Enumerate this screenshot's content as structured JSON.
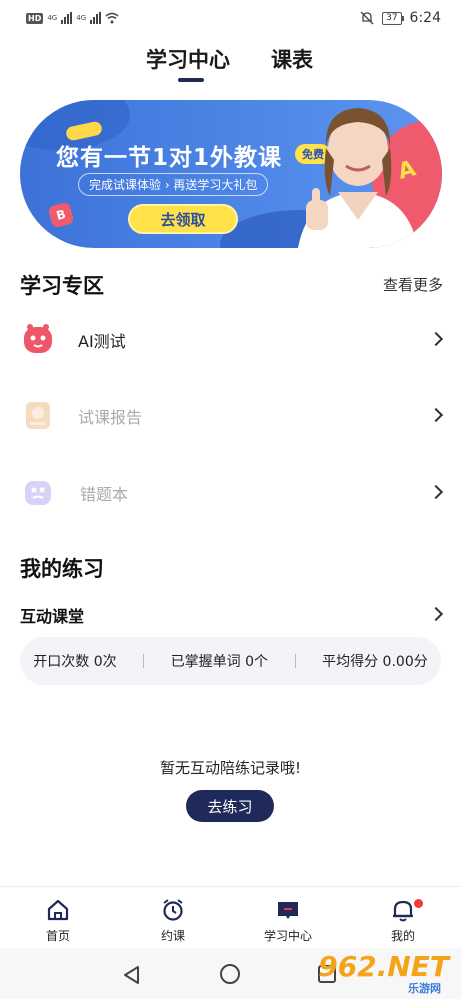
{
  "status_bar": {
    "network_hd": "HD",
    "signal1": "4G",
    "signal2": "4G",
    "battery": "37",
    "time": "6:24"
  },
  "tabs": [
    {
      "label": "学习中心"
    },
    {
      "label": "课表"
    }
  ],
  "banner": {
    "title": "您有一节1对1外教课",
    "free_badge": "免费",
    "subtitle": "完成试课体验 › 再送学习大礼包",
    "button": "去领取"
  },
  "study_zone": {
    "title": "学习专区",
    "see_more": "查看更多",
    "items": [
      {
        "label": "AI测试",
        "color": "#f0566a"
      },
      {
        "label": "试课报告",
        "color": "#f2c9a0"
      },
      {
        "label": "错题本",
        "color": "#c9c3f2"
      }
    ]
  },
  "practice": {
    "title": "我的练习",
    "interactive_class": "互动课堂",
    "stats": [
      "开口次数 0次",
      "已掌握单词 0个",
      "平均得分 0.00分"
    ],
    "empty_text": "暂无互动陪练记录哦!",
    "button": "去练习"
  },
  "bottom_nav": [
    {
      "label": "首页",
      "icon": "home-icon"
    },
    {
      "label": "约课",
      "icon": "alarm-clock-icon"
    },
    {
      "label": "学习中心",
      "icon": "study-center-icon"
    },
    {
      "label": "我的",
      "icon": "bell-icon"
    }
  ],
  "watermark": {
    "main": "962.NET",
    "sub": "乐游网"
  },
  "colors": {
    "primary": "#1f2a5a",
    "banner_blue": "#4f88e8",
    "badge_yellow": "#ffe14a",
    "notification_red": "#f03a3a"
  }
}
